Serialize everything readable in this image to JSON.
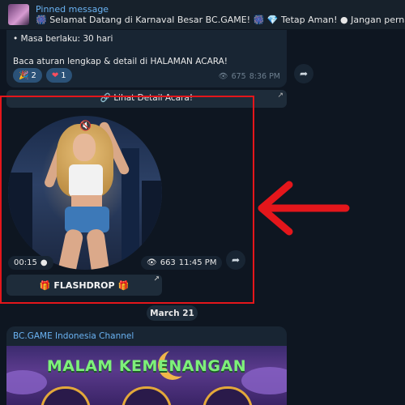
{
  "pinned": {
    "title": "Pinned message",
    "text": "🎆 Selamat Datang di Karnaval Besar BC.GAME! 🎆 💎 Tetap Aman! ● Jangan pernah percaya"
  },
  "top_message": {
    "lines": [
      "• Masa berlaku: 30 hari",
      "",
      "Baca aturan lengkap & detail di HALAMAN ACARA!"
    ],
    "reactions": [
      {
        "emoji": "🎉",
        "count": "2"
      },
      {
        "emoji": "❤",
        "count": "1"
      }
    ],
    "views": "675",
    "time": "8:36 PM",
    "button_label": "🔗 Lihat Detail Acara!"
  },
  "video_message": {
    "duration": "00:15",
    "views": "663",
    "time": "11:45 PM",
    "button_label": "FLASHDROP"
  },
  "date_divider": "March 21",
  "channel_post": {
    "channel_name": "BC.GAME Indonesia Channel",
    "banner_title": "MALAM KEMENANGAN"
  },
  "colors": {
    "background": "#0e1621",
    "bubble": "#182533",
    "accent": "#6ab3f3",
    "highlight": "#e4161b",
    "banner_text": "#7ef07a"
  },
  "icons": [
    "eye-icon",
    "forward-icon",
    "external-link-icon",
    "gift-icon",
    "mute-icon",
    "red-arrow-icon"
  ]
}
